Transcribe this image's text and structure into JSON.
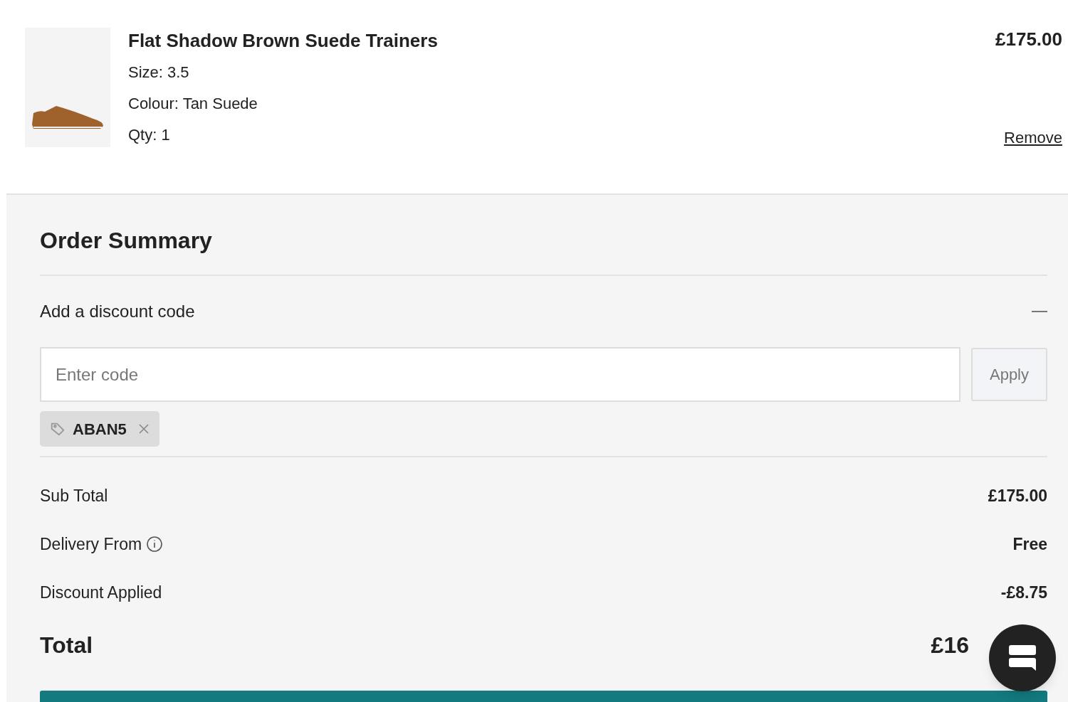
{
  "cart_item": {
    "name": "Flat Shadow Brown Suede Trainers",
    "details": [
      "Size: 3.5",
      "Colour: Tan Suede",
      "Qty: 1"
    ],
    "price": "£175.00",
    "remove": "Remove"
  },
  "order_summary": {
    "title": "Order Summary",
    "discount": {
      "label": "Add a discount code",
      "expanded": true,
      "placeholder": "Enter code",
      "apply": "Apply",
      "applied_codes": [
        "ABAN5"
      ]
    },
    "rows": [
      {
        "label": "Sub Total",
        "value": "£175.00",
        "info": false
      },
      {
        "label": "Delivery From",
        "value": "Free",
        "info": true
      },
      {
        "label": "Discount Applied",
        "value": "-£8.75",
        "info": false
      }
    ],
    "total": {
      "label": "Total",
      "value": "£16"
    }
  }
}
